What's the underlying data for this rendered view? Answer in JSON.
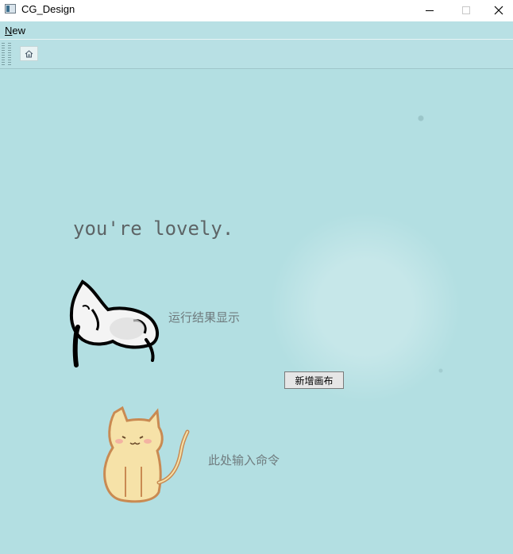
{
  "window": {
    "title": "CG_Design"
  },
  "menubar": {
    "items": [
      {
        "label_underlined": "N",
        "label_rest": "ew"
      }
    ]
  },
  "toolbar": {
    "buttons": [
      {
        "icon": "home-icon"
      }
    ]
  },
  "canvas": {
    "slogan": "you're lovely.",
    "result_label": "运行结果显示",
    "input_label": "此处输入命令",
    "new_canvas_button": "新增画布"
  },
  "colors": {
    "background": "#b3dfe2",
    "toolbar": "#b8e0e4",
    "label_text": "#6f7b7e"
  }
}
